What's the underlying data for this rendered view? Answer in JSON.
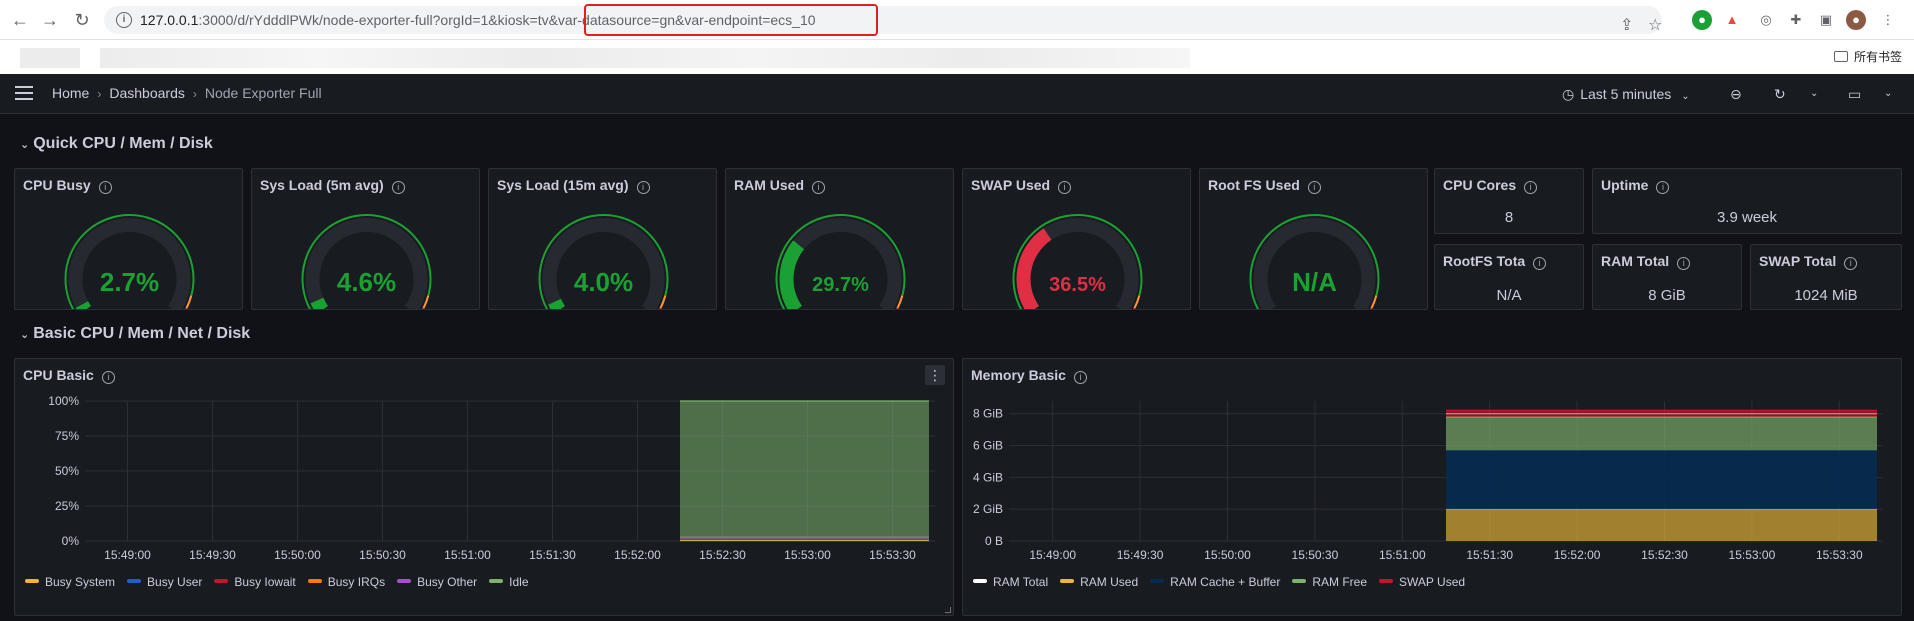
{
  "browser": {
    "url_host": "127.0.0.1",
    "url_rest": ":3000/d/rYdddlPWk/node-exporter-full?orgId=1&kiosk=tv&var-datasource=gn&var-endpoint=ecs_10",
    "bookmarks_folder": "所有书签"
  },
  "nav": {
    "breadcrumb": [
      "Home",
      "Dashboards",
      "Node Exporter Full"
    ],
    "time_range": "Last 5 minutes"
  },
  "rows": {
    "quick": "Quick CPU / Mem / Disk",
    "basic": "Basic CPU / Mem / Net / Disk"
  },
  "gauges": [
    {
      "title": "CPU Busy",
      "value": "2.7%",
      "fraction": 0.027,
      "color": "#1ba033"
    },
    {
      "title": "Sys Load (5m avg)",
      "value": "4.6%",
      "fraction": 0.046,
      "color": "#1ba033"
    },
    {
      "title": "Sys Load (15m avg)",
      "value": "4.0%",
      "fraction": 0.04,
      "color": "#1ba033"
    },
    {
      "title": "RAM Used",
      "value": "29.7%",
      "fraction": 0.297,
      "color": "#1ba033"
    },
    {
      "title": "SWAP Used",
      "value": "36.5%",
      "fraction": 0.365,
      "color": "#e02f44"
    },
    {
      "title": "Root FS Used",
      "value": "N/A",
      "fraction": 0,
      "color": "#1ba033"
    }
  ],
  "stats": {
    "cpu_cores": {
      "title": "CPU Cores",
      "value": "8"
    },
    "uptime": {
      "title": "Uptime",
      "value": "3.9 week"
    },
    "rootfs_total": {
      "title": "RootFS Tota",
      "value": "N/A"
    },
    "ram_total": {
      "title": "RAM Total",
      "value": "8 GiB"
    },
    "swap_total": {
      "title": "SWAP Total",
      "value": "1024 MiB"
    }
  },
  "chart_data": [
    {
      "type": "area",
      "title": "CPU Basic",
      "y_ticks": [
        "100%",
        "75%",
        "50%",
        "25%",
        "0%"
      ],
      "x_ticks": [
        "15:49:00",
        "15:49:30",
        "15:50:00",
        "15:50:30",
        "15:51:00",
        "15:51:30",
        "15:52:00",
        "15:52:30",
        "15:53:00",
        "15:53:30"
      ],
      "ylim": [
        0,
        100
      ],
      "data_start": "15:52:15",
      "data_end": "15:53:45",
      "series": [
        {
          "name": "Busy System",
          "color": "#eab839",
          "values": [
            0.6,
            0.6
          ]
        },
        {
          "name": "Busy User",
          "color": "#1f60c4",
          "values": [
            1.8,
            1.8
          ]
        },
        {
          "name": "Busy Iowait",
          "color": "#c4162a",
          "values": [
            0.1,
            0.1
          ]
        },
        {
          "name": "Busy IRQs",
          "color": "#ff780a",
          "values": [
            0.1,
            0.1
          ]
        },
        {
          "name": "Busy Other",
          "color": "#a352cc",
          "values": [
            0.1,
            0.1
          ]
        },
        {
          "name": "Idle",
          "color": "#7eb26d",
          "values": [
            97.3,
            97.3
          ]
        }
      ]
    },
    {
      "type": "area",
      "title": "Memory Basic",
      "y_ticks": [
        "8 GiB",
        "6 GiB",
        "4 GiB",
        "2 GiB",
        "0 B"
      ],
      "x_ticks": [
        "15:49:00",
        "15:49:30",
        "15:50:00",
        "15:50:30",
        "15:51:00",
        "15:51:30",
        "15:52:00",
        "15:52:30",
        "15:53:00",
        "15:53:30"
      ],
      "ylim": [
        0,
        8.8
      ],
      "data_start": "15:51:15",
      "data_end": "15:53:45",
      "series": [
        {
          "name": "RAM Total",
          "color": "#ffffff",
          "values": [
            8,
            8
          ]
        },
        {
          "name": "RAM Used",
          "color": "#eab839",
          "values": [
            2.0,
            2.0
          ]
        },
        {
          "name": "RAM Cache + Buffer",
          "color": "#052b51",
          "values": [
            3.7,
            3.7
          ]
        },
        {
          "name": "RAM Free",
          "color": "#7eb26d",
          "values": [
            2.1,
            2.1
          ]
        },
        {
          "name": "SWAP Used",
          "color": "#c4162a",
          "values": [
            0.4,
            0.4
          ]
        }
      ]
    }
  ]
}
